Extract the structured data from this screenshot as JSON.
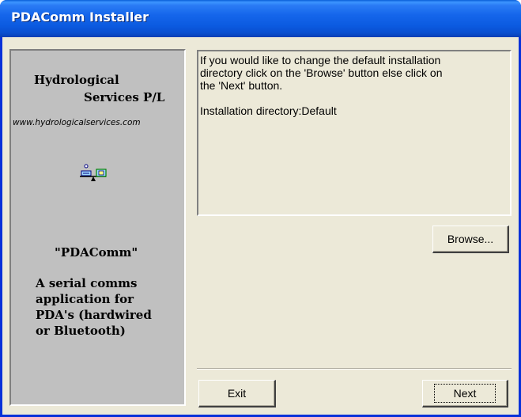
{
  "window": {
    "title": "PDAComm Installer"
  },
  "side_panel": {
    "company_line1": "Hydrological",
    "company_line2": "Services P/L",
    "website": "www.hydrologicalservices.com",
    "logo_icon": "scale-balance-icon",
    "app_name": "\"PDAComm\"",
    "description_lines": [
      "A serial comms",
      "application for",
      "PDA's (hardwired",
      "or Bluetooth)"
    ]
  },
  "info": {
    "lines": [
      "If you would like to change the default installation",
      "directory click on the 'Browse' button else click on",
      "the 'Next' button."
    ],
    "directory_text": "Installation directory:Default"
  },
  "buttons": {
    "browse": "Browse...",
    "exit": "Exit",
    "next": "Next"
  },
  "colors": {
    "titlebar": "#0a5fd8",
    "window_bg": "#ece9d8",
    "side_panel_bg": "#c0c0c0"
  }
}
